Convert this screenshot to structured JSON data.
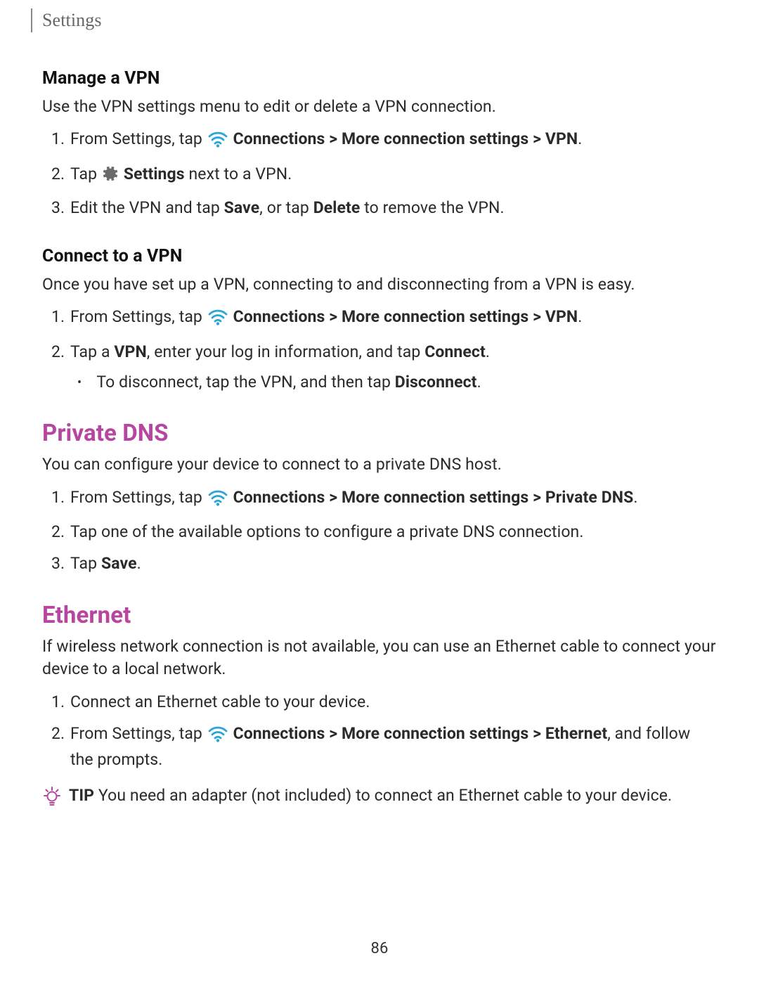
{
  "page": {
    "header": "Settings",
    "number": "86"
  },
  "colors": {
    "accent": "#B6469F",
    "wifi": "#2CA6D8"
  },
  "manageVpn": {
    "title": "Manage a VPN",
    "intro": "Use the VPN settings menu to edit or delete a VPN connection.",
    "step1_prefix": "From Settings, tap ",
    "step1_bold": "Connections > More connection settings > VPN",
    "step1_suffix": ".",
    "step2_prefix": "Tap ",
    "step2_bold": "Settings",
    "step2_suffix": " next to a VPN.",
    "step3_prefix": "Edit the VPN and tap ",
    "step3_bold1": "Save",
    "step3_mid": ", or tap ",
    "step3_bold2": "Delete",
    "step3_suffix": " to remove the VPN."
  },
  "connectVpn": {
    "title": "Connect to a VPN",
    "intro": "Once you have set up a VPN, connecting to and disconnecting from a VPN is easy.",
    "step1_prefix": "From Settings, tap ",
    "step1_bold": "Connections > More connection settings > VPN",
    "step1_suffix": ".",
    "step2_prefix": "Tap a ",
    "step2_bold1": "VPN",
    "step2_mid": ", enter your log in information, and tap ",
    "step2_bold2": "Connect",
    "step2_suffix": ".",
    "sub_prefix": "To disconnect, tap the VPN, and then tap ",
    "sub_bold": "Disconnect",
    "sub_suffix": "."
  },
  "privateDns": {
    "title": "Private DNS",
    "intro": "You can configure your device to connect to a private DNS host.",
    "step1_prefix": "From Settings, tap ",
    "step1_bold": "Connections > More connection settings > Private DNS",
    "step1_suffix": ".",
    "step2": "Tap one of the available options to configure a private DNS connection.",
    "step3_prefix": "Tap ",
    "step3_bold": "Save",
    "step3_suffix": "."
  },
  "ethernet": {
    "title": "Ethernet",
    "intro": "If wireless network connection is not available, you can use an Ethernet cable to connect your device to a local network.",
    "step1": "Connect an Ethernet cable to your device.",
    "step2_prefix": "From Settings, tap ",
    "step2_bold": "Connections > More connection settings > Ethernet",
    "step2_suffix": ", and follow the prompts.",
    "tip_label": "TIP",
    "tip_text": "  You need an adapter (not included) to connect an Ethernet cable to your device."
  }
}
